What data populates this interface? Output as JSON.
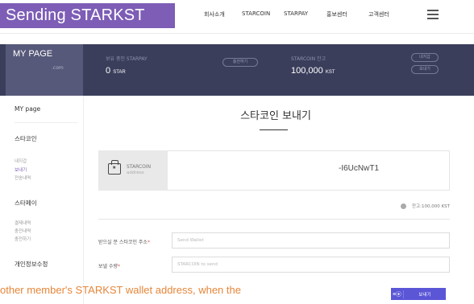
{
  "header": {
    "title": "Sending STARKST",
    "nav": [
      "회사소개",
      "STARCOIN",
      "STARPAY",
      "홍보센터",
      "고객센터"
    ]
  },
  "banner": {
    "mypage_title": "MY PAGE",
    "mypage_sub": ".com",
    "holding_label": "보유 중인 STARPAY",
    "holding_value": "0",
    "holding_unit": "STAR",
    "charge_btn": "충전하기",
    "coin_label": "STARCOIN 잔고",
    "coin_value": "100,000",
    "coin_unit": "KST",
    "receive_btn": "내지갑",
    "send_btn": "보내기"
  },
  "sidebar": {
    "mypage": "MY page",
    "starcoin_heading": "스타코인",
    "starcoin_items": [
      "내지갑",
      "보내기",
      "전송내역"
    ],
    "starpay_heading": "스타페이",
    "starpay_items": [
      "결제내역",
      "충전내역",
      "충전하기"
    ],
    "personal": "개인정보수정"
  },
  "main": {
    "page_title": "스타코인 보내기",
    "address_label_1": "STARCOIN",
    "address_label_2": "address",
    "address_value": "-I6UcNwT1",
    "balance": "잔고:100,000 KST",
    "recipient_label": "받으실 분 스타코인 주소",
    "recipient_placeholder": "Send Wallet",
    "amount_label": "보낼 수량",
    "amount_placeholder": "STARCOIN to send",
    "send_label": "보내기"
  },
  "caption": "other member's STARKST wallet address, when the",
  "colors": {
    "accent": "#7d5db6",
    "banner_bg": "#3a3e5b",
    "button": "#5a56d6",
    "caption": "#e6863a"
  }
}
